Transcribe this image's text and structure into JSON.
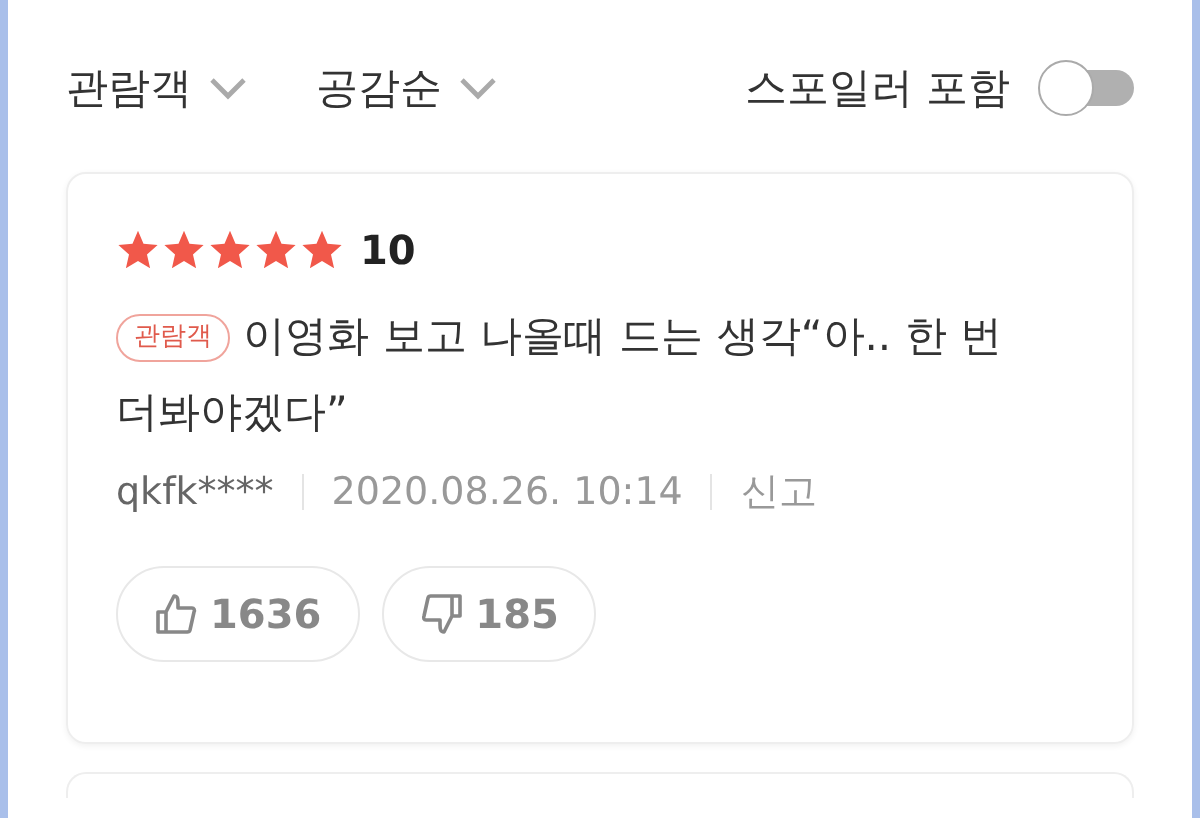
{
  "filters": [
    {
      "label": "관람객"
    },
    {
      "label": "공감순"
    }
  ],
  "spoiler_toggle": {
    "label": "스포일러 포함",
    "on": false
  },
  "reviews": [
    {
      "stars": 5,
      "score": "10",
      "badge": "관람객",
      "text": "이영화 보고 나올때 드는 생각“아.. 한 번 더봐야겠다”",
      "author": "qkfk****",
      "date": "2020.08.26. 10:14",
      "report": "신고",
      "likes": "1636",
      "dislikes": "185"
    }
  ]
}
